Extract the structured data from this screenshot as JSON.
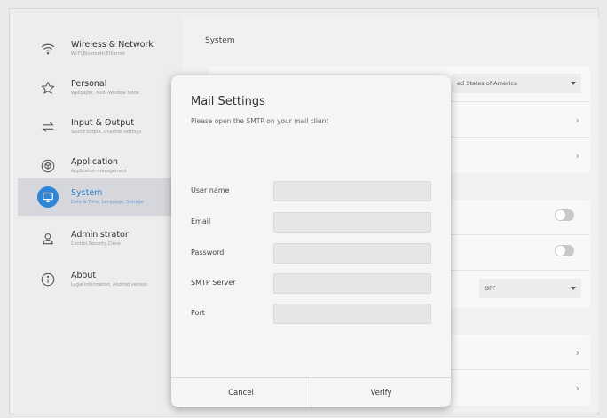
{
  "sidebar": {
    "items": [
      {
        "label": "Wireless & Network",
        "sub": "Wi-Fi,Bluetooth,Ethernet",
        "icon": "wifi-icon"
      },
      {
        "label": "Personal",
        "sub": "Wallpaper, Multi-Window Mode",
        "icon": "star-icon"
      },
      {
        "label": "Input & Output",
        "sub": "Sound output, Channel settings",
        "icon": "swap-arrows-icon"
      },
      {
        "label": "Application",
        "sub": "Application management",
        "icon": "cube-icon"
      },
      {
        "label": "System",
        "sub": "Date & Time, Language, Storage",
        "icon": "monitor-icon"
      },
      {
        "label": "Administrator",
        "sub": "Control,Security,Clone",
        "icon": "user-icon"
      },
      {
        "label": "About",
        "sub": "Legal information, Android version",
        "icon": "info-icon"
      }
    ],
    "active_index": 4
  },
  "main": {
    "title": "System",
    "language_select": "ed States of America",
    "off_select": "OFF"
  },
  "dialog": {
    "title": "Mail Settings",
    "description": "Please open the SMTP on your mail client",
    "fields": [
      {
        "label": "User name",
        "value": ""
      },
      {
        "label": "Email",
        "value": ""
      },
      {
        "label": "Password",
        "value": ""
      },
      {
        "label": "SMTP Server",
        "value": ""
      },
      {
        "label": "Port",
        "value": ""
      }
    ],
    "cancel_label": "Cancel",
    "verify_label": "Verify"
  },
  "colors": {
    "accent": "#2f86d6",
    "background": "#ededee",
    "dialog": "#f5f5f6"
  }
}
